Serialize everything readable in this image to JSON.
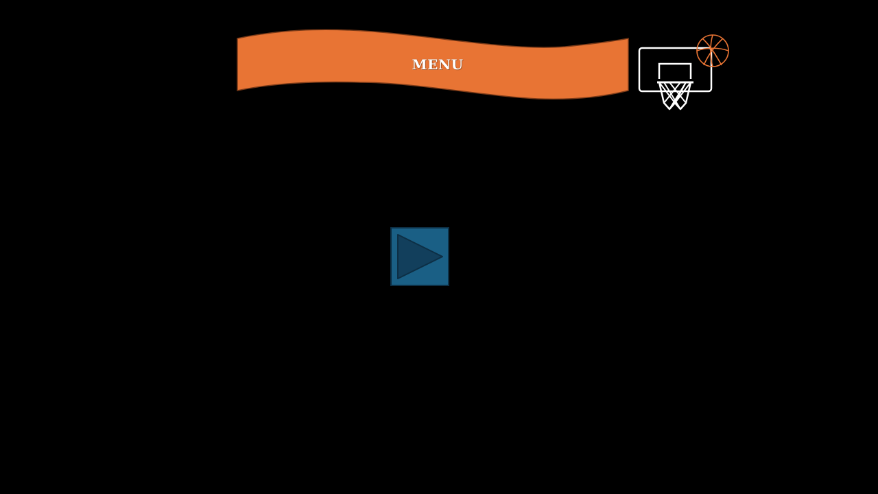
{
  "menu": {
    "title": "MENU"
  },
  "colors": {
    "background": "#000000",
    "banner_fill": "#e87434",
    "banner_outline": "#7a3a18",
    "hoop_line": "#ffffff",
    "ball_line": "#e87434",
    "play_fill": "#1a5f85",
    "play_border": "#0d2f45",
    "play_triangle": "#123f5c"
  },
  "icons": {
    "hoop": "basketball-hoop-icon",
    "ball": "basketball-icon",
    "play": "play-triangle-icon"
  }
}
